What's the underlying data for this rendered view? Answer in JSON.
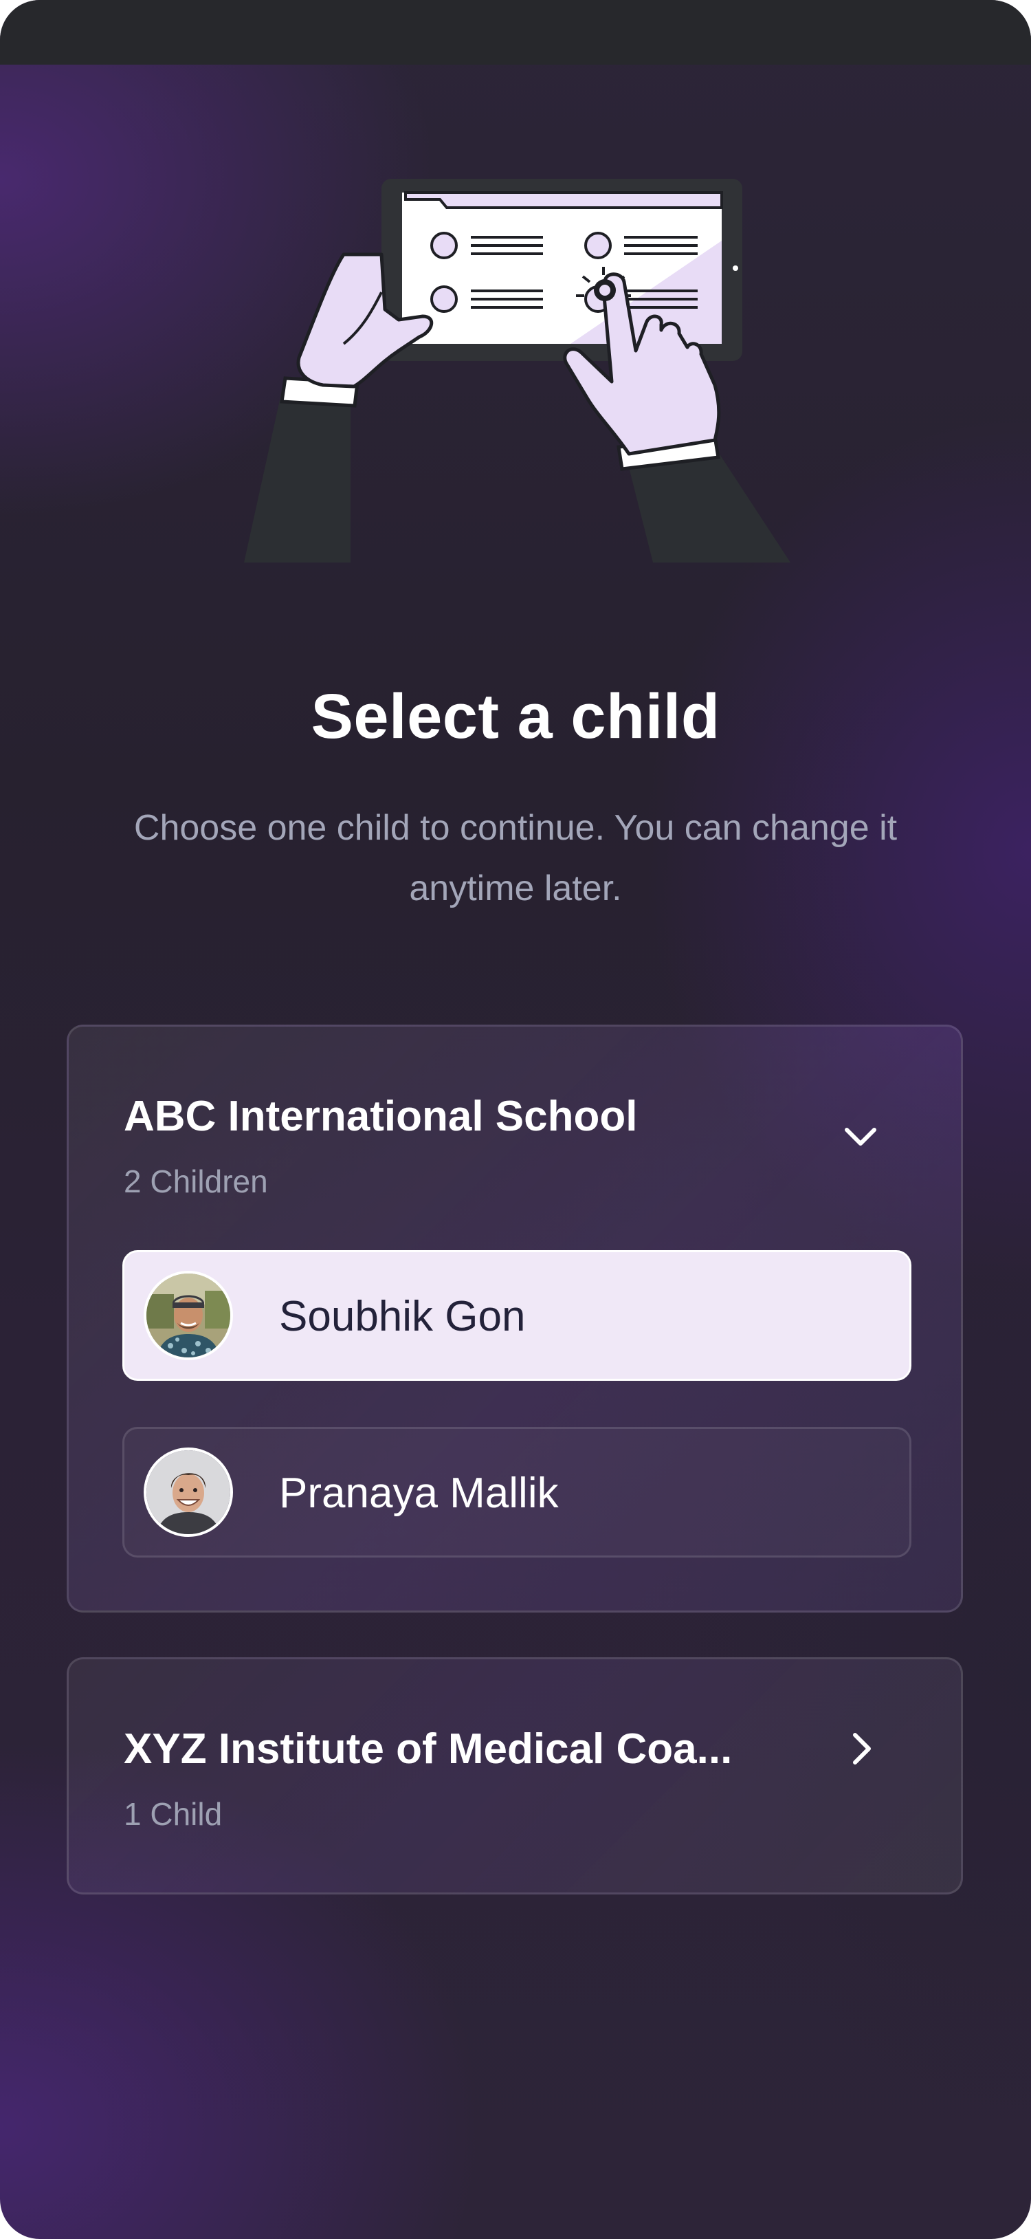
{
  "page": {
    "title": "Select a child",
    "subtitle": "Choose one child to continue. You can change it anytime later."
  },
  "schools": [
    {
      "name": "ABC International School",
      "count": "2 Children",
      "expanded": true,
      "chevron_icon": "chevron-down-icon",
      "children": [
        {
          "name": "Soubhik Gon",
          "selected": true,
          "avatar_icon": "avatar-photo"
        },
        {
          "name": "Pranaya Mallik",
          "selected": false,
          "avatar_icon": "avatar-photo"
        }
      ]
    },
    {
      "name": "XYZ Institute of Medical Coa...",
      "count": "1 Child",
      "expanded": false,
      "chevron_icon": "chevron-right-icon"
    }
  ],
  "colors": {
    "background_dark": "#27212f",
    "background_purple": "#4e2a78",
    "selected_row": "#f0e8f7",
    "text_primary": "#ffffff",
    "text_secondary": "#a3a6b9",
    "illustration_accent": "#e8dcf6"
  }
}
